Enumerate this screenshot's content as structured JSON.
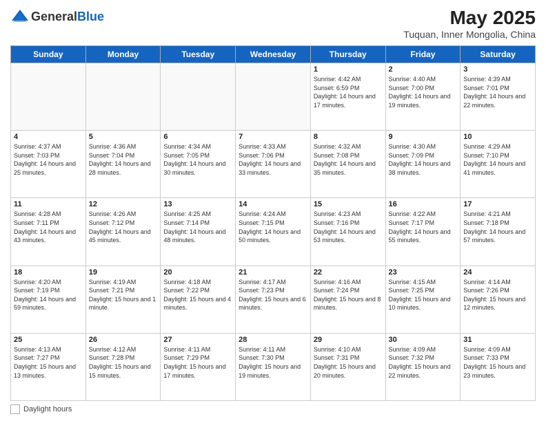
{
  "header": {
    "logo_general": "General",
    "logo_blue": "Blue",
    "month_year": "May 2025",
    "location": "Tuquan, Inner Mongolia, China"
  },
  "days_of_week": [
    "Sunday",
    "Monday",
    "Tuesday",
    "Wednesday",
    "Thursday",
    "Friday",
    "Saturday"
  ],
  "weeks": [
    [
      {
        "day": "",
        "info": ""
      },
      {
        "day": "",
        "info": ""
      },
      {
        "day": "",
        "info": ""
      },
      {
        "day": "",
        "info": ""
      },
      {
        "day": "1",
        "info": "Sunrise: 4:42 AM\nSunset: 6:59 PM\nDaylight: 14 hours and 17 minutes."
      },
      {
        "day": "2",
        "info": "Sunrise: 4:40 AM\nSunset: 7:00 PM\nDaylight: 14 hours and 19 minutes."
      },
      {
        "day": "3",
        "info": "Sunrise: 4:39 AM\nSunset: 7:01 PM\nDaylight: 14 hours and 22 minutes."
      }
    ],
    [
      {
        "day": "4",
        "info": "Sunrise: 4:37 AM\nSunset: 7:03 PM\nDaylight: 14 hours and 25 minutes."
      },
      {
        "day": "5",
        "info": "Sunrise: 4:36 AM\nSunset: 7:04 PM\nDaylight: 14 hours and 28 minutes."
      },
      {
        "day": "6",
        "info": "Sunrise: 4:34 AM\nSunset: 7:05 PM\nDaylight: 14 hours and 30 minutes."
      },
      {
        "day": "7",
        "info": "Sunrise: 4:33 AM\nSunset: 7:06 PM\nDaylight: 14 hours and 33 minutes."
      },
      {
        "day": "8",
        "info": "Sunrise: 4:32 AM\nSunset: 7:08 PM\nDaylight: 14 hours and 35 minutes."
      },
      {
        "day": "9",
        "info": "Sunrise: 4:30 AM\nSunset: 7:09 PM\nDaylight: 14 hours and 38 minutes."
      },
      {
        "day": "10",
        "info": "Sunrise: 4:29 AM\nSunset: 7:10 PM\nDaylight: 14 hours and 41 minutes."
      }
    ],
    [
      {
        "day": "11",
        "info": "Sunrise: 4:28 AM\nSunset: 7:11 PM\nDaylight: 14 hours and 43 minutes."
      },
      {
        "day": "12",
        "info": "Sunrise: 4:26 AM\nSunset: 7:12 PM\nDaylight: 14 hours and 45 minutes."
      },
      {
        "day": "13",
        "info": "Sunrise: 4:25 AM\nSunset: 7:14 PM\nDaylight: 14 hours and 48 minutes."
      },
      {
        "day": "14",
        "info": "Sunrise: 4:24 AM\nSunset: 7:15 PM\nDaylight: 14 hours and 50 minutes."
      },
      {
        "day": "15",
        "info": "Sunrise: 4:23 AM\nSunset: 7:16 PM\nDaylight: 14 hours and 53 minutes."
      },
      {
        "day": "16",
        "info": "Sunrise: 4:22 AM\nSunset: 7:17 PM\nDaylight: 14 hours and 55 minutes."
      },
      {
        "day": "17",
        "info": "Sunrise: 4:21 AM\nSunset: 7:18 PM\nDaylight: 14 hours and 57 minutes."
      }
    ],
    [
      {
        "day": "18",
        "info": "Sunrise: 4:20 AM\nSunset: 7:19 PM\nDaylight: 14 hours and 59 minutes."
      },
      {
        "day": "19",
        "info": "Sunrise: 4:19 AM\nSunset: 7:21 PM\nDaylight: 15 hours and 1 minute."
      },
      {
        "day": "20",
        "info": "Sunrise: 4:18 AM\nSunset: 7:22 PM\nDaylight: 15 hours and 4 minutes."
      },
      {
        "day": "21",
        "info": "Sunrise: 4:17 AM\nSunset: 7:23 PM\nDaylight: 15 hours and 6 minutes."
      },
      {
        "day": "22",
        "info": "Sunrise: 4:16 AM\nSunset: 7:24 PM\nDaylight: 15 hours and 8 minutes."
      },
      {
        "day": "23",
        "info": "Sunrise: 4:15 AM\nSunset: 7:25 PM\nDaylight: 15 hours and 10 minutes."
      },
      {
        "day": "24",
        "info": "Sunrise: 4:14 AM\nSunset: 7:26 PM\nDaylight: 15 hours and 12 minutes."
      }
    ],
    [
      {
        "day": "25",
        "info": "Sunrise: 4:13 AM\nSunset: 7:27 PM\nDaylight: 15 hours and 13 minutes."
      },
      {
        "day": "26",
        "info": "Sunrise: 4:12 AM\nSunset: 7:28 PM\nDaylight: 15 hours and 15 minutes."
      },
      {
        "day": "27",
        "info": "Sunrise: 4:11 AM\nSunset: 7:29 PM\nDaylight: 15 hours and 17 minutes."
      },
      {
        "day": "28",
        "info": "Sunrise: 4:11 AM\nSunset: 7:30 PM\nDaylight: 15 hours and 19 minutes."
      },
      {
        "day": "29",
        "info": "Sunrise: 4:10 AM\nSunset: 7:31 PM\nDaylight: 15 hours and 20 minutes."
      },
      {
        "day": "30",
        "info": "Sunrise: 4:09 AM\nSunset: 7:32 PM\nDaylight: 15 hours and 22 minutes."
      },
      {
        "day": "31",
        "info": "Sunrise: 4:09 AM\nSunset: 7:33 PM\nDaylight: 15 hours and 23 minutes."
      }
    ]
  ],
  "footer": {
    "label": "Daylight hours"
  }
}
